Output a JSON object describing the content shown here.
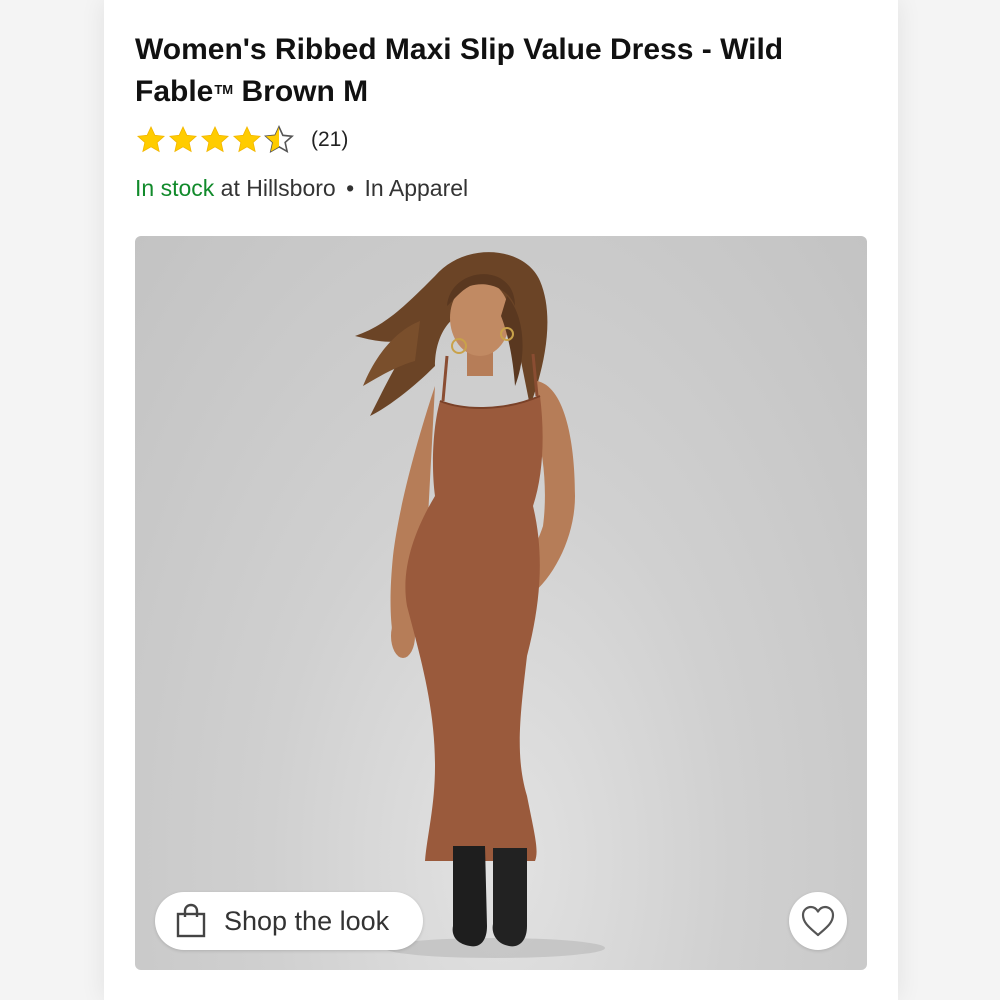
{
  "product": {
    "title_main": "Women's Ribbed Maxi Slip Value Dress - Wild Fable",
    "title_tm": "TM",
    "title_tail": "Brown M",
    "rating": {
      "value": 4.5,
      "max": 5,
      "count_text": "(21)",
      "star_color": "#ffcc00"
    },
    "availability": {
      "status": "In stock",
      "status_color": "#118a2b",
      "store_text": "at Hillsboro",
      "separator": "•",
      "department_text": "In Apparel"
    }
  },
  "image": {
    "description_icon": "model-photo",
    "shop_the_look": {
      "label": "Shop the look",
      "icon": "shopping-bag-icon"
    },
    "favorite": {
      "icon": "heart-icon"
    }
  }
}
